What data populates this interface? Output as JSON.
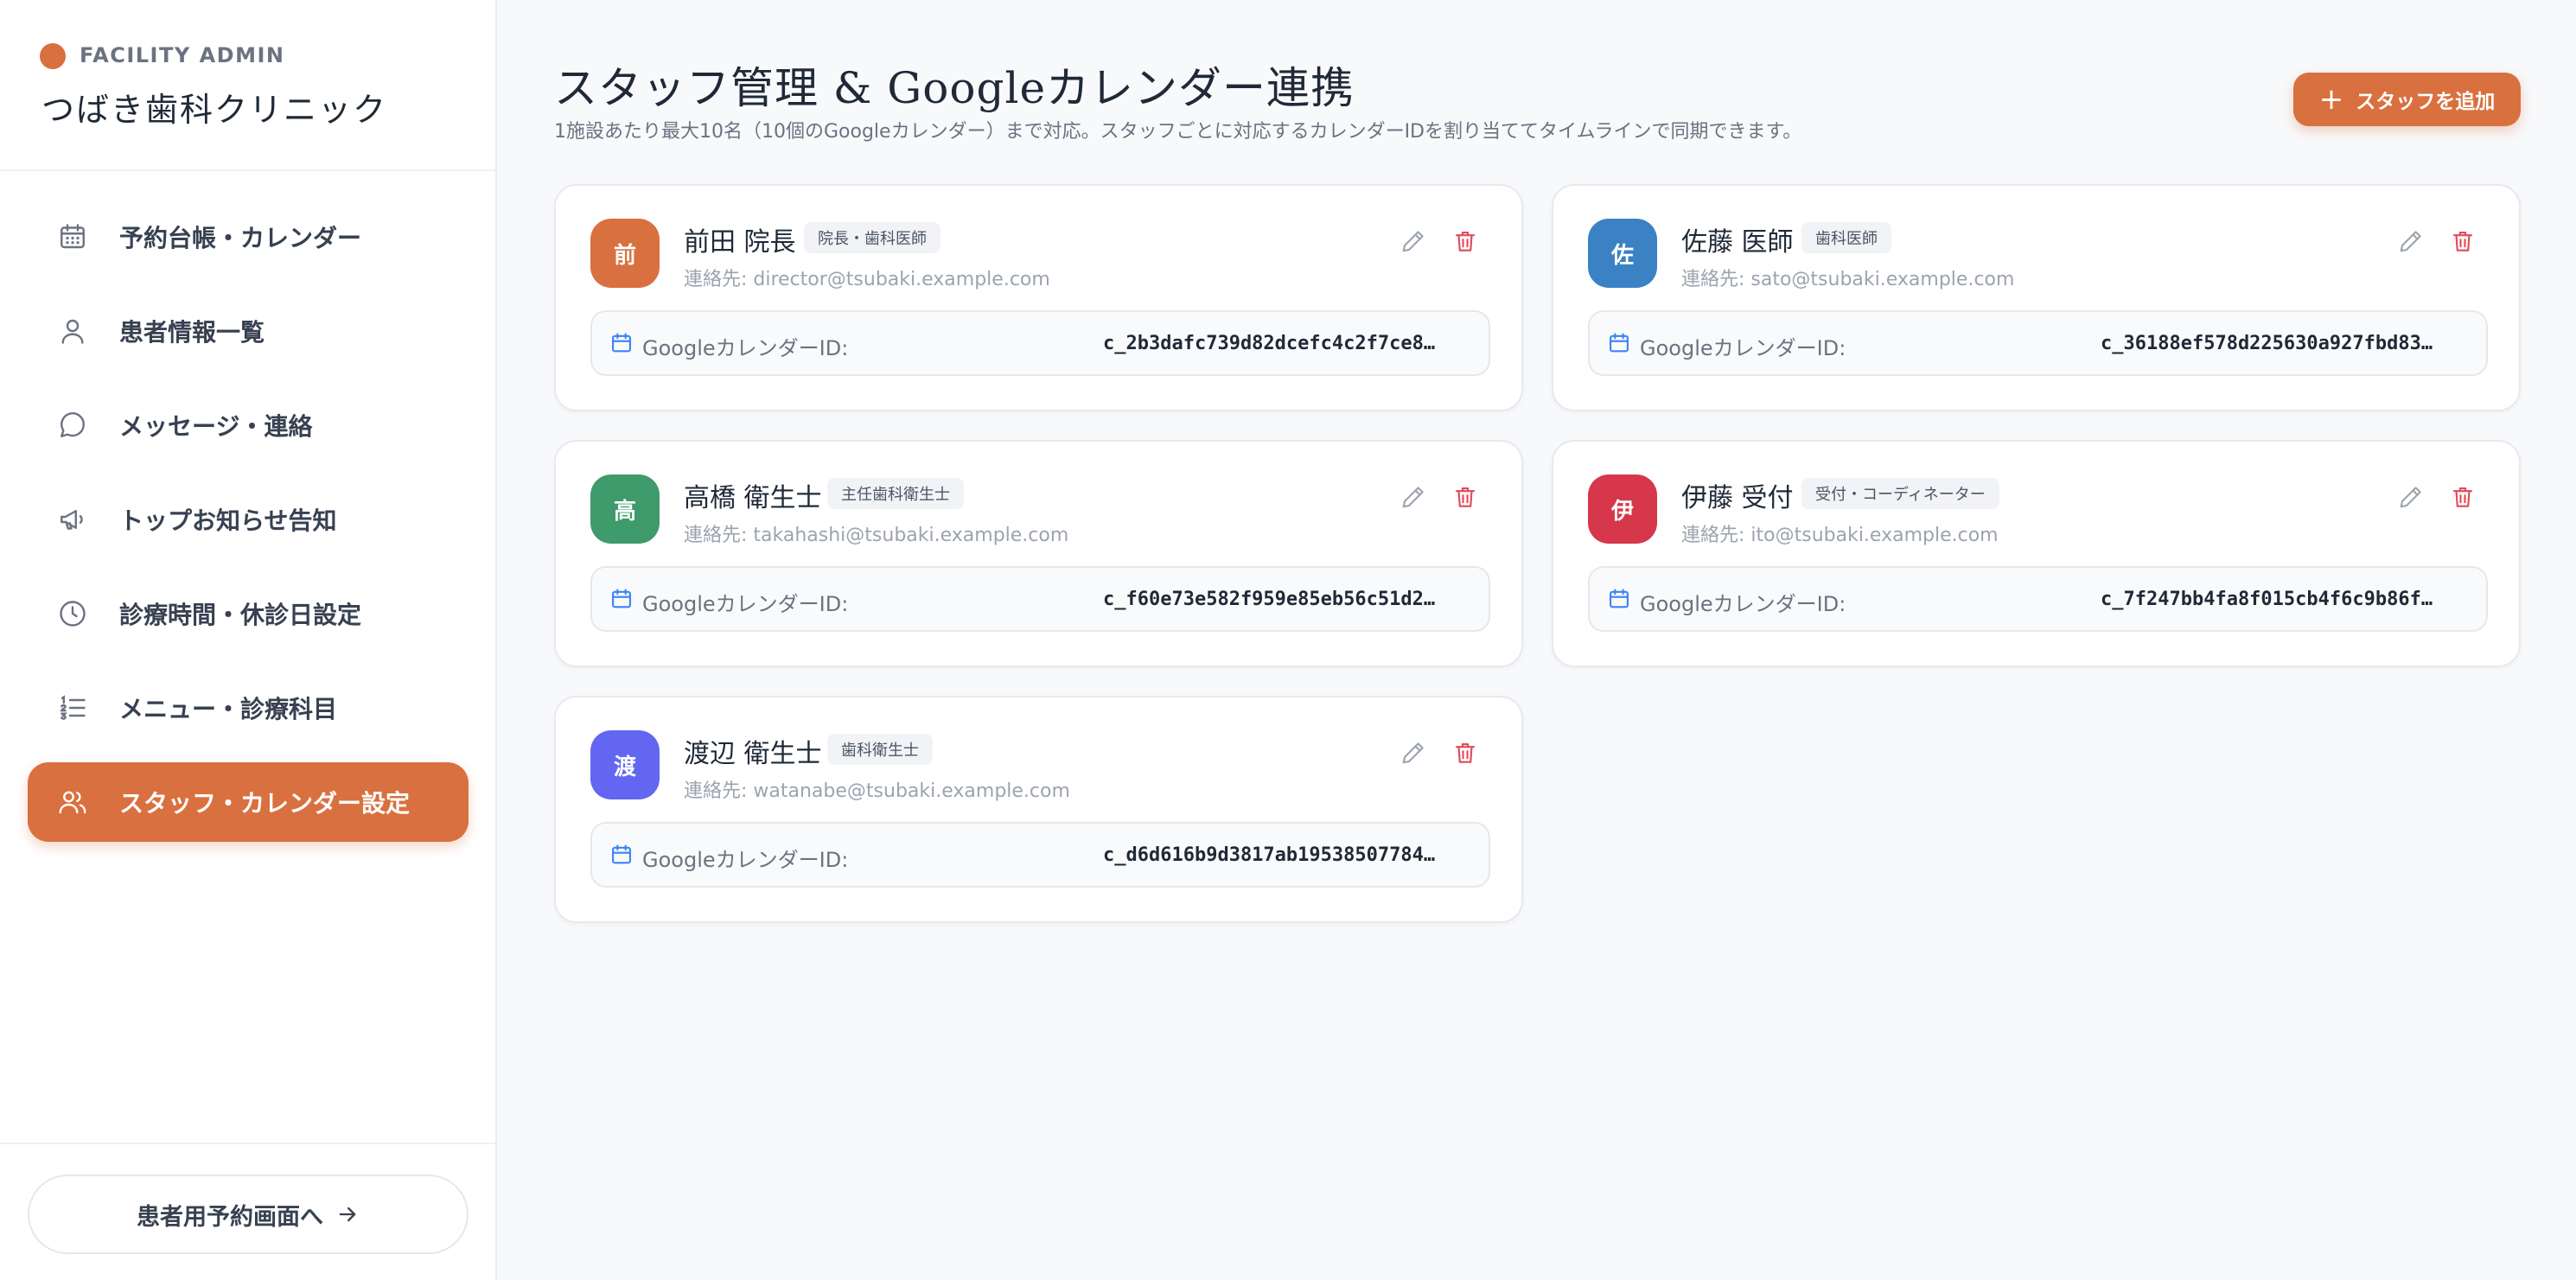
{
  "sidebar": {
    "kicker": "FACILITY ADMIN",
    "clinic_name": "つばき歯科クリニック",
    "brand_color": "#d9703f",
    "items": [
      {
        "label": "予約台帳・カレンダー",
        "icon": "calendar-icon"
      },
      {
        "label": "患者情報一覧",
        "icon": "user-icon"
      },
      {
        "label": "メッセージ・連絡",
        "icon": "message-icon"
      },
      {
        "label": "トップお知らせ告知",
        "icon": "megaphone-icon"
      },
      {
        "label": "診療時間・休診日設定",
        "icon": "clock-icon"
      },
      {
        "label": "メニュー・診療科目",
        "icon": "list-ordered-icon"
      },
      {
        "label": "スタッフ・カレンダー設定",
        "icon": "users-icon",
        "active": true
      }
    ],
    "footer_button": "患者用予約画面へ"
  },
  "header": {
    "title": "スタッフ管理 & Googleカレンダー連携",
    "subtitle": "1施設あたり最大10名（10個のGoogleカレンダー）まで対応。スタッフごとに対応するカレンダーIDを割り当ててタイムラインで同期できます。",
    "add_button": "スタッフを追加"
  },
  "calendar_label": "GoogleカレンダーID:",
  "staff": [
    {
      "initial": "前",
      "name": "前田 院長",
      "role": "院長・歯科医師",
      "contact": "連絡先: director@tsubaki.example.com",
      "calendar_id": "c_2b3dafc739d82dcefc4c2f7ce8…",
      "color": "#d9703f"
    },
    {
      "initial": "佐",
      "name": "佐藤 医師",
      "role": "歯科医師",
      "contact": "連絡先: sato@tsubaki.example.com",
      "calendar_id": "c_36188ef578d225630a927fbd83…",
      "color": "#3b82c4"
    },
    {
      "initial": "高",
      "name": "高橋 衛生士",
      "role": "主任歯科衛生士",
      "contact": "連絡先: takahashi@tsubaki.example.com",
      "calendar_id": "c_f60e73e582f959e85eb56c51d2…",
      "color": "#3f9a6c"
    },
    {
      "initial": "伊",
      "name": "伊藤 受付",
      "role": "受付・コーディネーター",
      "contact": "連絡先: ito@tsubaki.example.com",
      "calendar_id": "c_7f247bb4fa8f015cb4f6c9b86f…",
      "color": "#d6374a"
    },
    {
      "initial": "渡",
      "name": "渡辺 衛生士",
      "role": "歯科衛生士",
      "contact": "連絡先: watanabe@tsubaki.example.com",
      "calendar_id": "c_d6d616b9d3817ab19538507784…",
      "color": "#6366f1"
    }
  ]
}
